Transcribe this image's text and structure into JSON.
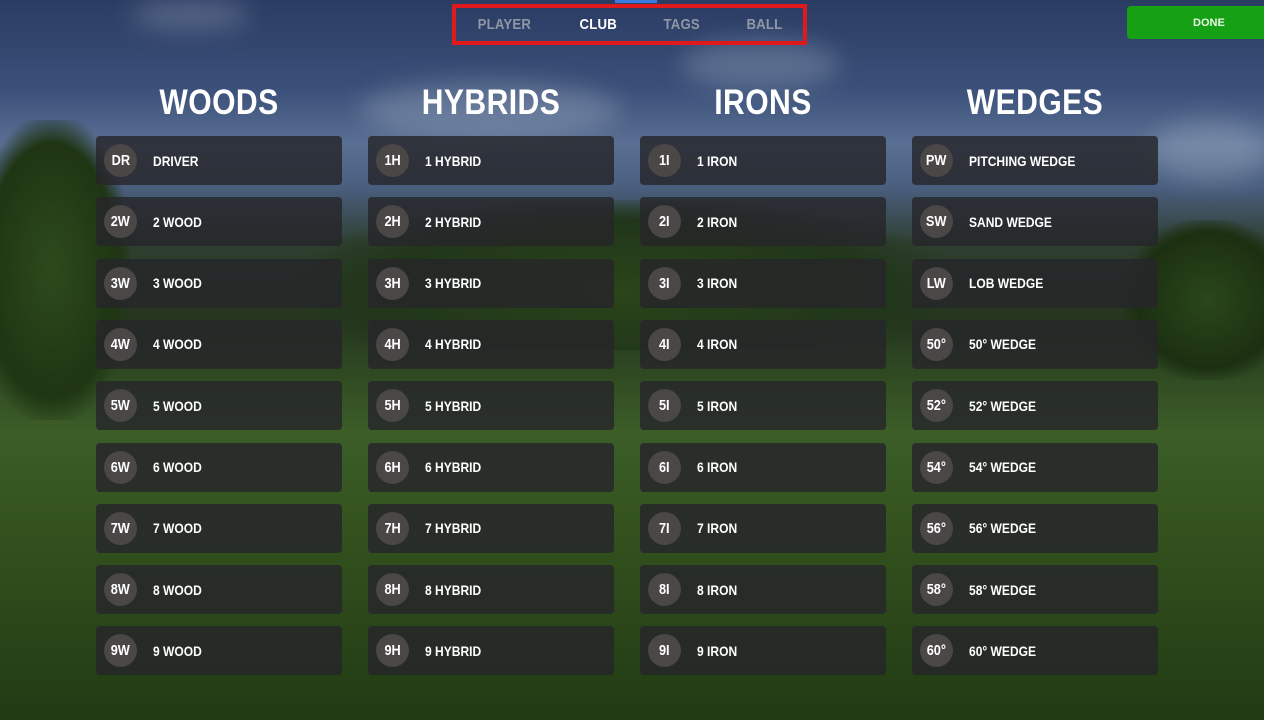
{
  "tabs": [
    {
      "label": "PLAYER",
      "active": false
    },
    {
      "label": "CLUB",
      "active": true
    },
    {
      "label": "TAGS",
      "active": false
    },
    {
      "label": "BALL",
      "active": false
    }
  ],
  "done_label": "DONE",
  "categories": [
    {
      "title": "WOODS",
      "clubs": [
        {
          "badge": "DR",
          "name": "DRIVER"
        },
        {
          "badge": "2W",
          "name": "2 WOOD"
        },
        {
          "badge": "3W",
          "name": "3 WOOD"
        },
        {
          "badge": "4W",
          "name": "4 WOOD"
        },
        {
          "badge": "5W",
          "name": "5 WOOD"
        },
        {
          "badge": "6W",
          "name": "6 WOOD"
        },
        {
          "badge": "7W",
          "name": "7 WOOD"
        },
        {
          "badge": "8W",
          "name": "8 WOOD"
        },
        {
          "badge": "9W",
          "name": "9 WOOD"
        }
      ]
    },
    {
      "title": "HYBRIDS",
      "clubs": [
        {
          "badge": "1H",
          "name": "1 HYBRID"
        },
        {
          "badge": "2H",
          "name": "2 HYBRID"
        },
        {
          "badge": "3H",
          "name": "3 HYBRID"
        },
        {
          "badge": "4H",
          "name": "4 HYBRID"
        },
        {
          "badge": "5H",
          "name": "5 HYBRID"
        },
        {
          "badge": "6H",
          "name": "6 HYBRID"
        },
        {
          "badge": "7H",
          "name": "7 HYBRID"
        },
        {
          "badge": "8H",
          "name": "8 HYBRID"
        },
        {
          "badge": "9H",
          "name": "9 HYBRID"
        }
      ]
    },
    {
      "title": "IRONS",
      "clubs": [
        {
          "badge": "1I",
          "name": "1 IRON"
        },
        {
          "badge": "2I",
          "name": "2 IRON"
        },
        {
          "badge": "3I",
          "name": "3 IRON"
        },
        {
          "badge": "4I",
          "name": "4 IRON"
        },
        {
          "badge": "5I",
          "name": "5 IRON"
        },
        {
          "badge": "6I",
          "name": "6 IRON"
        },
        {
          "badge": "7I",
          "name": "7 IRON"
        },
        {
          "badge": "8I",
          "name": "8 IRON"
        },
        {
          "badge": "9I",
          "name": "9 IRON"
        }
      ]
    },
    {
      "title": "WEDGES",
      "clubs": [
        {
          "badge": "PW",
          "name": "PITCHING WEDGE"
        },
        {
          "badge": "SW",
          "name": "SAND WEDGE"
        },
        {
          "badge": "LW",
          "name": "LOB WEDGE"
        },
        {
          "badge": "50°",
          "name": "50° WEDGE"
        },
        {
          "badge": "52°",
          "name": "52° WEDGE"
        },
        {
          "badge": "54°",
          "name": "54° WEDGE"
        },
        {
          "badge": "56°",
          "name": "56° WEDGE"
        },
        {
          "badge": "58°",
          "name": "58° WEDGE"
        },
        {
          "badge": "60°",
          "name": "60° WEDGE"
        }
      ]
    }
  ]
}
